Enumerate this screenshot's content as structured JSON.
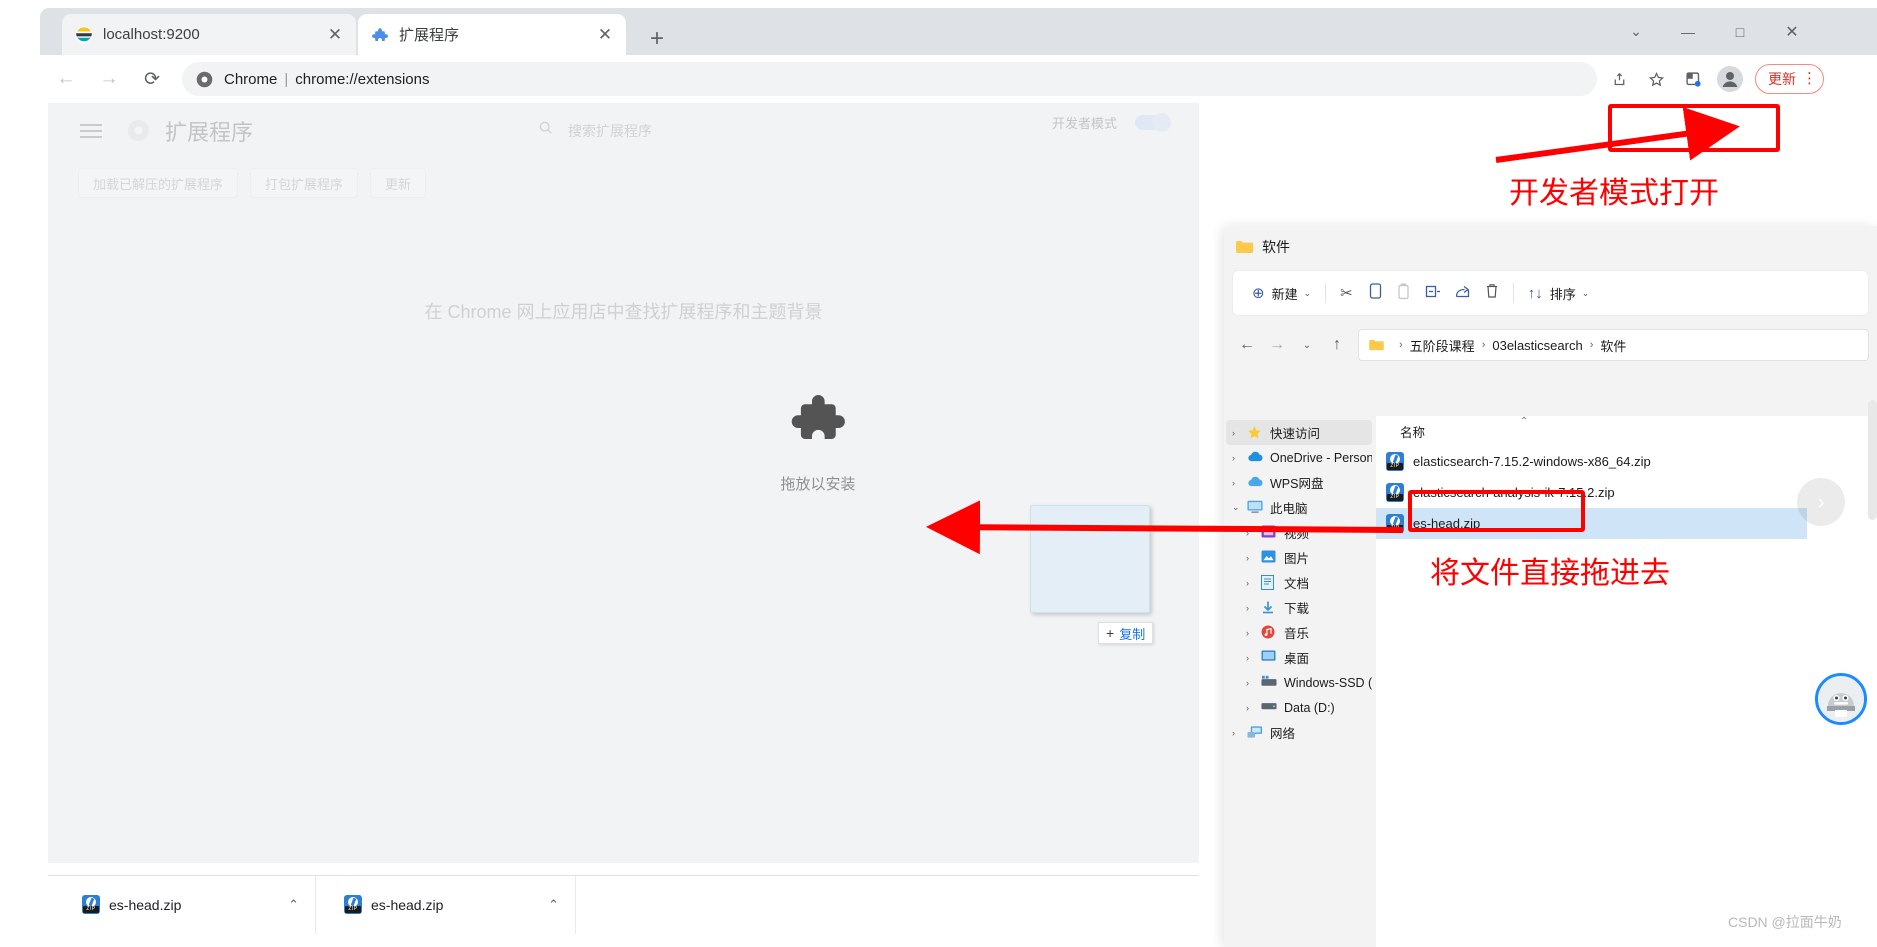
{
  "browser": {
    "tabs": [
      {
        "title": "localhost:9200",
        "favicon": "elastic-icon",
        "active": false
      },
      {
        "title": "扩展程序",
        "favicon": "puzzle-icon",
        "active": true
      }
    ],
    "new_tab_glyph": "+",
    "window_controls": {
      "chevron": "⌄",
      "minimize": "—",
      "maximize": "□",
      "close": "✕"
    },
    "omnibox": {
      "scheme_label": "Chrome",
      "separator": "|",
      "url": "chrome://extensions"
    },
    "toolbar": {
      "share_icon": "share-icon",
      "bookmark_icon": "star-icon",
      "extension_icon": "extensions-icon",
      "profile_icon": "profile-avatar-icon",
      "update_label": "更新",
      "menu_dots": "⋮"
    },
    "nav": {
      "back": "←",
      "forward": "→",
      "reload": "⟳"
    }
  },
  "extensions_page": {
    "title": "扩展程序",
    "search_placeholder": "搜索扩展程序",
    "buttons": [
      "加载已解压的扩展程序",
      "打包扩展程序",
      "更新"
    ],
    "dev_mode_label": "开发者模式",
    "dev_mode_on": true,
    "webstore_text": "在 Chrome 网上应用店中查找扩展程序和主题背景",
    "dropzone_label": "拖放以安装",
    "drag_badge": {
      "plus": "+",
      "label": "复制"
    }
  },
  "downloads": [
    {
      "name": "es-head.zip",
      "caret": "⌃"
    },
    {
      "name": "es-head.zip",
      "caret": "⌃"
    }
  ],
  "explorer": {
    "window_title": "软件",
    "toolbar": {
      "new_label": "新建",
      "new_caret": "⌄",
      "cut": "✂",
      "copy": "❐",
      "paste": "📋",
      "rename": "⊟",
      "share": "↗",
      "delete": "🗑",
      "sort_glyph": "↑↓",
      "sort_label": "排序",
      "sort_caret": "⌄"
    },
    "address": {
      "back": "←",
      "forward": "→",
      "recent": "⌄",
      "up": "↑",
      "crumbs": [
        "五阶段课程",
        "03elasticsearch",
        "软件"
      ],
      "separator": "›"
    },
    "sidebar": [
      {
        "label": "快速访问",
        "icon": "star-icon",
        "caret": "›",
        "indent": false,
        "selected": true
      },
      {
        "label": "OneDrive - Persona",
        "icon": "onedrive-cloud-icon",
        "caret": "›",
        "indent": false,
        "selected": false
      },
      {
        "label": "WPS网盘",
        "icon": "wps-cloud-icon",
        "caret": "›",
        "indent": false,
        "selected": false
      },
      {
        "label": "此电脑",
        "icon": "this-pc-monitor-icon",
        "caret": "⌄",
        "indent": false,
        "selected": false
      },
      {
        "label": "视频",
        "icon": "videos-icon",
        "caret": "›",
        "indent": true,
        "selected": false
      },
      {
        "label": "图片",
        "icon": "pictures-icon",
        "caret": "›",
        "indent": true,
        "selected": false
      },
      {
        "label": "文档",
        "icon": "documents-icon",
        "caret": "›",
        "indent": true,
        "selected": false
      },
      {
        "label": "下载",
        "icon": "downloads-icon",
        "caret": "›",
        "indent": true,
        "selected": false
      },
      {
        "label": "音乐",
        "icon": "music-icon",
        "caret": "›",
        "indent": true,
        "selected": false
      },
      {
        "label": "桌面",
        "icon": "desktop-icon",
        "caret": "›",
        "indent": true,
        "selected": false
      },
      {
        "label": "Windows-SSD (C:)",
        "icon": "system-drive-icon",
        "caret": "›",
        "indent": true,
        "selected": false
      },
      {
        "label": "Data (D:)",
        "icon": "drive-icon",
        "caret": "›",
        "indent": true,
        "selected": false
      },
      {
        "label": "网络",
        "icon": "network-icon",
        "caret": "›",
        "indent": false,
        "selected": false
      }
    ],
    "column_header": "名称",
    "sort_mark": "⌃",
    "files": [
      {
        "name": "elasticsearch-7.15.2-windows-x86_64.zip",
        "icon": "zip-file-icon",
        "selected": false
      },
      {
        "name": "elasticsearch-analysis-ik-7.15.2.zip",
        "icon": "zip-file-icon",
        "selected": false
      },
      {
        "name": "es-head.zip",
        "icon": "zip-file-icon",
        "selected": true
      }
    ]
  },
  "annotations": {
    "color": "#ff0000",
    "dev_mode_note": "开发者模式打开",
    "drag_file_note": "将文件直接拖进去"
  },
  "overlays": {
    "carousel_next_glyph": "›",
    "assistant_name": "assistant-robot-avatar",
    "watermark": "CSDN @拉面牛奶"
  }
}
